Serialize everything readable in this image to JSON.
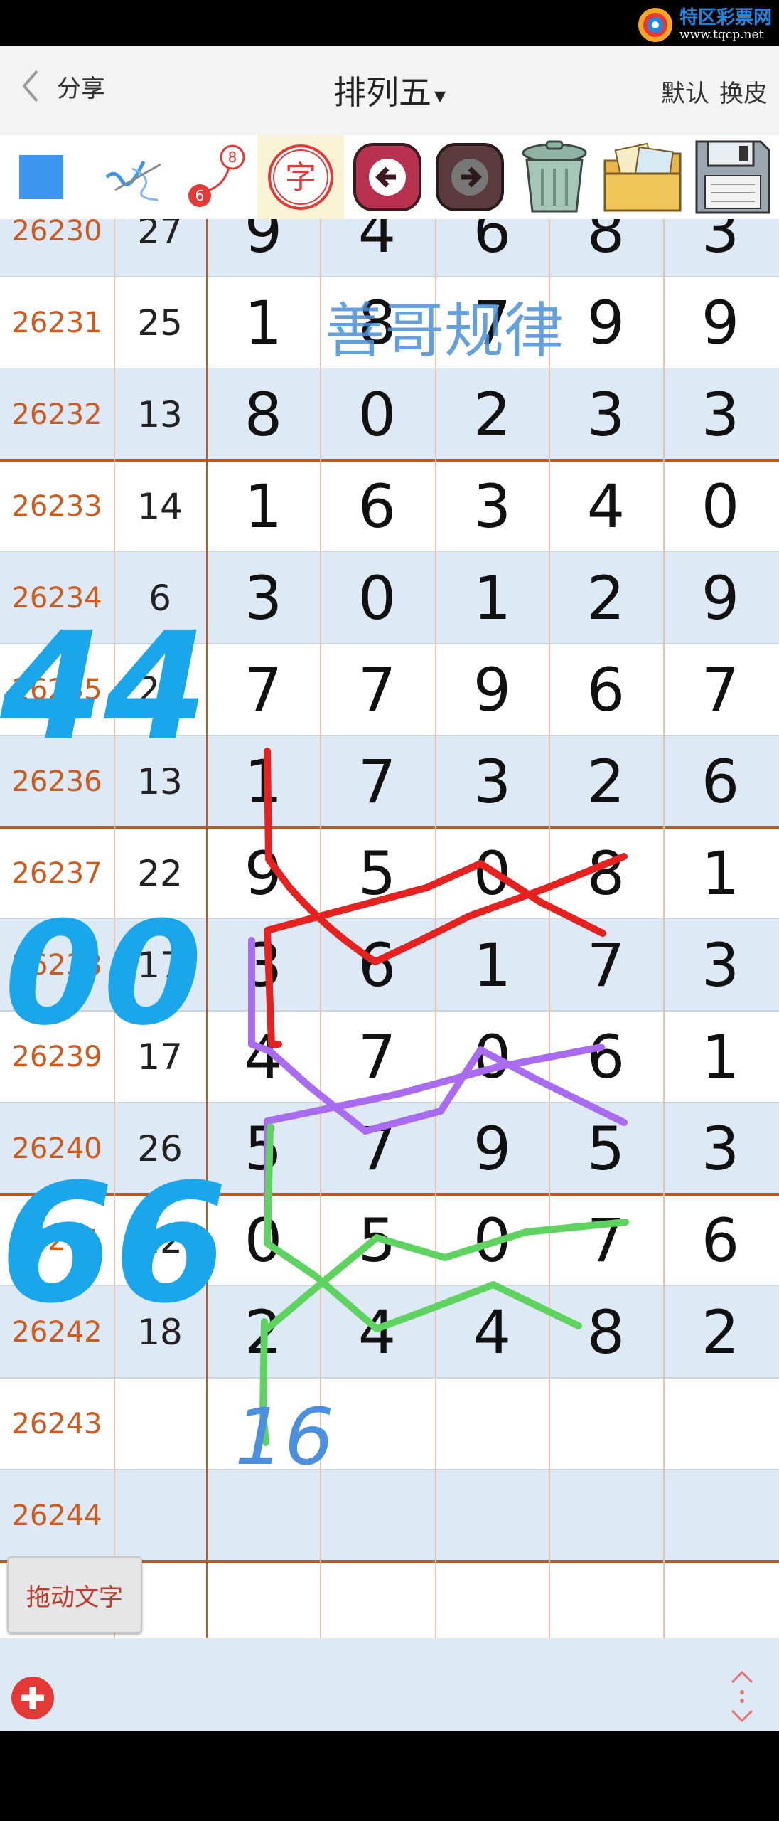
{
  "watermark": {
    "title": "特区彩票网",
    "url": "www.tqcp.net"
  },
  "header": {
    "back_label": "分享",
    "title": "排列五",
    "title_caret": "▾",
    "right_default": "默认",
    "right_skin": "换皮"
  },
  "toolbar": {
    "icons": [
      "color-square-icon",
      "pen-check-icon",
      "jump-line-icon",
      "char-icon",
      "undo-icon",
      "redo-icon",
      "trash-icon",
      "photos-icon",
      "save-icon"
    ],
    "char_glyph": "字",
    "jump_badge_top": "8",
    "jump_badge_bottom": "6",
    "accent": "#3b97ef"
  },
  "watermark_overlay": "善哥规律",
  "rows": [
    {
      "period": "26230",
      "sum": "27",
      "digits": [
        "9",
        "4",
        "6",
        "8",
        "3"
      ]
    },
    {
      "period": "26231",
      "sum": "25",
      "digits": [
        "1",
        "8",
        "7",
        "9",
        "9"
      ]
    },
    {
      "period": "26232",
      "sum": "13",
      "digits": [
        "8",
        "0",
        "2",
        "3",
        "3"
      ]
    },
    {
      "period": "26233",
      "sum": "14",
      "digits": [
        "1",
        "6",
        "3",
        "4",
        "0"
      ]
    },
    {
      "period": "26234",
      "sum": "6",
      "digits": [
        "3",
        "0",
        "1",
        "2",
        "9"
      ]
    },
    {
      "period": "26235",
      "sum": "29",
      "digits": [
        "7",
        "7",
        "9",
        "6",
        "7"
      ]
    },
    {
      "period": "26236",
      "sum": "13",
      "digits": [
        "1",
        "7",
        "3",
        "2",
        "6"
      ]
    },
    {
      "period": "26237",
      "sum": "22",
      "digits": [
        "9",
        "5",
        "0",
        "8",
        "1"
      ]
    },
    {
      "period": "26238",
      "sum": "17",
      "digits": [
        "3",
        "6",
        "1",
        "7",
        "3"
      ]
    },
    {
      "period": "26239",
      "sum": "17",
      "digits": [
        "4",
        "7",
        "0",
        "6",
        "1"
      ]
    },
    {
      "period": "26240",
      "sum": "26",
      "digits": [
        "5",
        "7",
        "9",
        "5",
        "3"
      ]
    },
    {
      "period": "26241",
      "sum": "12",
      "digits": [
        "0",
        "5",
        "0",
        "7",
        "6"
      ]
    },
    {
      "period": "26242",
      "sum": "18",
      "digits": [
        "2",
        "4",
        "4",
        "8",
        "2"
      ]
    },
    {
      "period": "26243",
      "sum": "",
      "digits": [
        "",
        "",
        "",
        "",
        ""
      ]
    },
    {
      "period": "26244",
      "sum": "",
      "digits": [
        "",
        "",
        "",
        "",
        ""
      ]
    }
  ],
  "handwriting": {
    "left_notes": [
      "44",
      "00",
      "66"
    ],
    "bottom_note": "16",
    "colors": {
      "note": "#19a6ea",
      "red": "#e5221f",
      "purple": "#a96bf0",
      "green": "#5fd35f",
      "bottom": "#4a8fe0"
    }
  },
  "drag_button_label": "拖动文字",
  "colors": {
    "period": "#d0591d",
    "shaded": "#dde9f4",
    "rule": "#c0571b"
  }
}
